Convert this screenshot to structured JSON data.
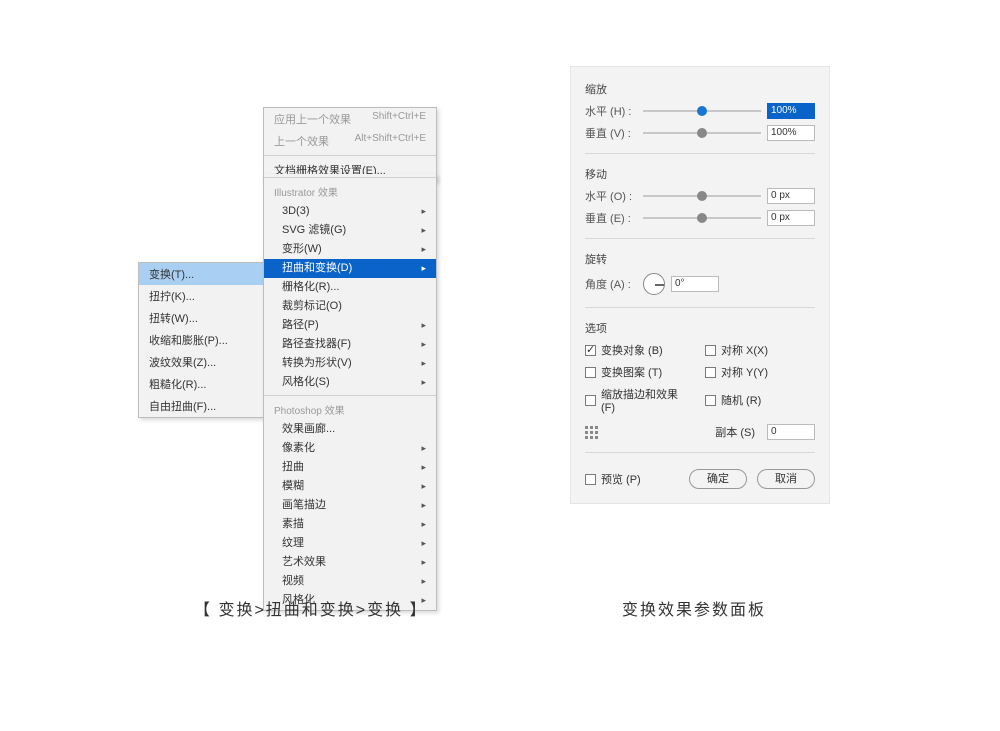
{
  "submenu_root": {
    "items": [
      {
        "label": "变换(T)...",
        "selected": true
      },
      {
        "label": "扭拧(K)..."
      },
      {
        "label": "扭转(W)..."
      },
      {
        "label": "收缩和膨胀(P)..."
      },
      {
        "label": "波纹效果(Z)..."
      },
      {
        "label": "粗糙化(R)..."
      },
      {
        "label": "自由扭曲(F)..."
      }
    ]
  },
  "menu_top": {
    "apply_last": "应用上一个效果",
    "apply_last_sc": "Shift+Ctrl+E",
    "last": "上一个效果",
    "last_sc": "Alt+Shift+Ctrl+E",
    "raster_settings": "文档栅格效果设置(E)..."
  },
  "menu_sub": {
    "group_illustrator": "Illustrator 效果",
    "illustrator_items": [
      {
        "label": "3D(3)",
        "sub": true
      },
      {
        "label": "SVG 滤镜(G)",
        "sub": true
      },
      {
        "label": "变形(W)",
        "sub": true
      },
      {
        "label": "扭曲和变换(D)",
        "sub": true,
        "highlight": true
      },
      {
        "label": "栅格化(R)..."
      },
      {
        "label": "裁剪标记(O)"
      },
      {
        "label": "路径(P)",
        "sub": true
      },
      {
        "label": "路径查找器(F)",
        "sub": true
      },
      {
        "label": "转换为形状(V)",
        "sub": true
      },
      {
        "label": "风格化(S)",
        "sub": true
      }
    ],
    "group_photoshop": "Photoshop 效果",
    "photoshop_items": [
      {
        "label": "效果画廊..."
      },
      {
        "label": "像素化",
        "sub": true
      },
      {
        "label": "扭曲",
        "sub": true
      },
      {
        "label": "模糊",
        "sub": true
      },
      {
        "label": "画笔描边",
        "sub": true
      },
      {
        "label": "素描",
        "sub": true
      },
      {
        "label": "纹理",
        "sub": true
      },
      {
        "label": "艺术效果",
        "sub": true
      },
      {
        "label": "视频",
        "sub": true
      },
      {
        "label": "风格化",
        "sub": true
      }
    ]
  },
  "panel": {
    "scale": {
      "title": "缩放",
      "h_label": "水平 (H) :",
      "h_value": "100%",
      "v_label": "垂直 (V) :",
      "v_value": "100%"
    },
    "move": {
      "title": "移动",
      "h_label": "水平 (O) :",
      "h_value": "0 px",
      "v_label": "垂直 (E) :",
      "v_value": "0 px"
    },
    "rotate": {
      "title": "旋转",
      "angle_label": "角度 (A) :",
      "angle_value": "0°"
    },
    "options": {
      "title": "选项",
      "c1": "变换对象 (B)",
      "c2": "对称 X(X)",
      "c3": "变换图案 (T)",
      "c4": "对称 Y(Y)",
      "c5": "缩放描边和效果 (F)",
      "c6": "随机 (R)",
      "c1_on": true
    },
    "copies_label": "副本 (S)",
    "copies_value": "0",
    "preview_label": "预览 (P)",
    "ok": "确定",
    "cancel": "取消"
  },
  "captions": {
    "left": "【 变换>扭曲和变换>变换 】",
    "right": "变换效果参数面板"
  }
}
